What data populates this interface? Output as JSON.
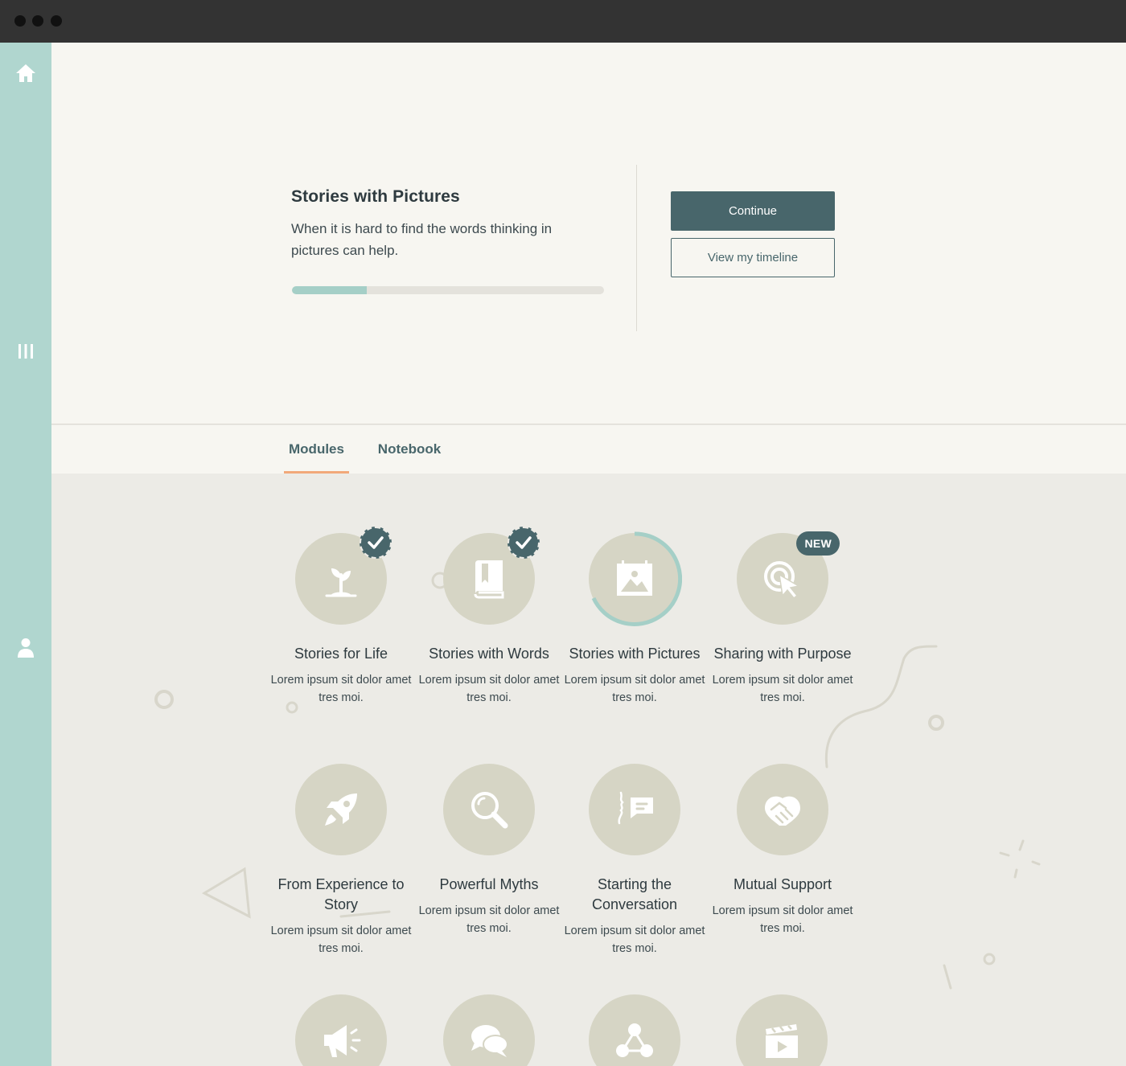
{
  "window": {
    "controls": [
      "close",
      "minimize",
      "maximize"
    ]
  },
  "sidebar": {
    "items": [
      {
        "name": "home",
        "icon": "home-icon"
      },
      {
        "name": "library",
        "icon": "library-icon"
      },
      {
        "name": "profile",
        "icon": "user-icon"
      }
    ],
    "background": "#b0d6cf"
  },
  "hero": {
    "title": "Stories with Pictures",
    "description": "When it is hard to find the words thinking in pictures can help.",
    "progress_fraction": 0.24,
    "continue_label": "Continue",
    "timeline_label": "View my timeline"
  },
  "tabs": [
    {
      "label": "Modules",
      "active": true
    },
    {
      "label": "Notebook",
      "active": false
    }
  ],
  "modules": [
    {
      "title": "Stories for Life",
      "desc": "Lorem ipsum sit dolor amet tres moi.",
      "icon": "sprout-icon",
      "status": "complete"
    },
    {
      "title": "Stories with Words",
      "desc": "Lorem ipsum sit dolor amet tres moi.",
      "icon": "book-icon",
      "status": "complete"
    },
    {
      "title": "Stories with Pictures",
      "desc": "Lorem ipsum sit dolor amet tres moi.",
      "icon": "picture-icon",
      "status": "in-progress"
    },
    {
      "title": "Sharing with Purpose",
      "desc": "Lorem ipsum sit dolor amet tres moi.",
      "icon": "target-cursor-icon",
      "status": "new",
      "badge": "NEW"
    },
    {
      "title": "From Experience to Story",
      "desc": "Lorem ipsum sit dolor amet tres moi.",
      "icon": "rocket-icon",
      "status": ""
    },
    {
      "title": "Powerful Myths",
      "desc": "Lorem ipsum sit dolor amet tres moi.",
      "icon": "magnifier-icon",
      "status": ""
    },
    {
      "title": "Starting the Conversation",
      "desc": "Lorem ipsum sit dolor amet tres moi.",
      "icon": "conversation-icon",
      "status": ""
    },
    {
      "title": "Mutual Support",
      "desc": "Lorem ipsum sit dolor amet tres moi.",
      "icon": "handshake-icon",
      "status": ""
    },
    {
      "title": "",
      "desc": "",
      "icon": "megaphone-icon",
      "status": ""
    },
    {
      "title": "",
      "desc": "",
      "icon": "chat-bubbles-icon",
      "status": ""
    },
    {
      "title": "",
      "desc": "",
      "icon": "network-icon",
      "status": ""
    },
    {
      "title": "",
      "desc": "",
      "icon": "clapperboard-icon",
      "status": ""
    }
  ],
  "colors": {
    "accent": "#48666b",
    "tab_underline": "#f2a97a",
    "progress": "#a5cfc7",
    "module_circle": "#d6d5c5"
  }
}
